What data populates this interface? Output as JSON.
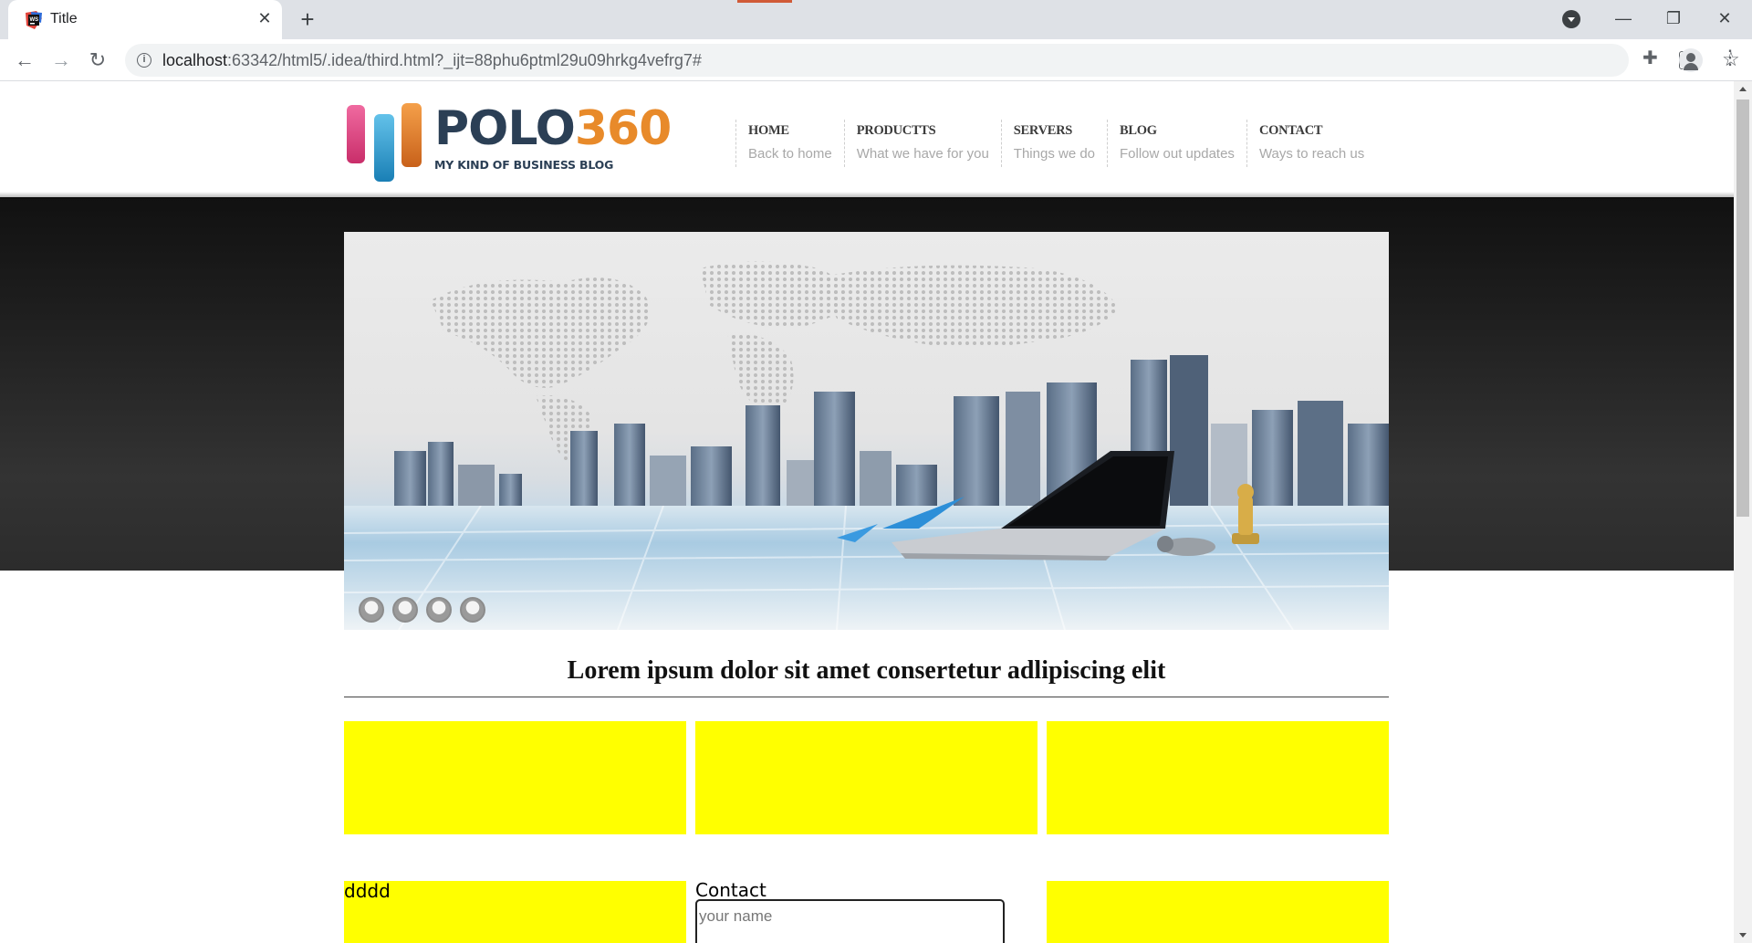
{
  "browser": {
    "tab_title": "Title",
    "tab_close": "✕",
    "new_tab": "+",
    "url_host": "localhost",
    "url_rest": ":63342/html5/.idea/third.html?_ijt=88phu6ptml29u09hrkg4vefrg7#",
    "controls": {
      "minimize": "—",
      "restore": "❐",
      "close": "✕"
    },
    "icons": {
      "back": "back-arrow-icon",
      "forward": "forward-arrow-icon",
      "reload": "reload-icon",
      "info": "info-icon",
      "translate": "translate-icon",
      "bookmark": "star-icon",
      "extensions": "puzzle-icon",
      "profile": "profile-icon",
      "menu": "kebab-menu-icon"
    }
  },
  "logo": {
    "name_letters": "POLO",
    "name_number": "360",
    "tagline": "MY KIND OF BUSINESS BLOG",
    "bar_colors": [
      "#d9417d",
      "#2ea3d6",
      "#e8822a"
    ]
  },
  "nav": [
    {
      "title": "HOME",
      "subtitle": "Back to home"
    },
    {
      "title": "PRODUCTTS",
      "subtitle": "What we have for you"
    },
    {
      "title": "SERVERS",
      "subtitle": "Things we do"
    },
    {
      "title": "BLOG",
      "subtitle": "Follow out updates"
    },
    {
      "title": "CONTACT",
      "subtitle": "Ways to reach us"
    }
  ],
  "slider": {
    "image": "city-skyline-with-laptop-banner",
    "dot_count": 4
  },
  "main": {
    "headline": "Lorem ipsum dolor sit amet consertetur adlipiscing elit",
    "box_color": "#ffff00",
    "lower_left_text": "dddd",
    "contact_label": "Contact",
    "name_placeholder": "your name"
  }
}
